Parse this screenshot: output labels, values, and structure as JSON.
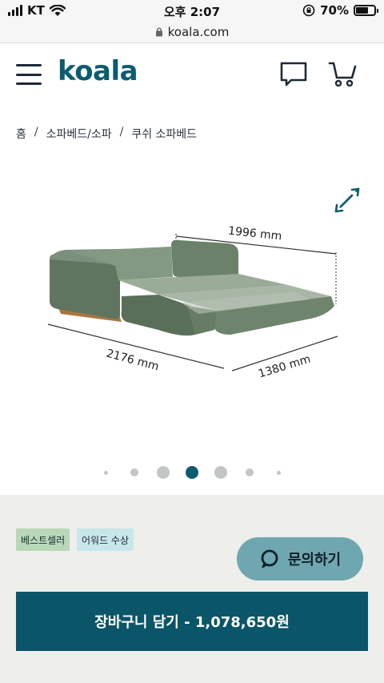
{
  "status_bar": {
    "carrier": "KT",
    "time": "오후 2:07",
    "battery": "70%",
    "battery_level": 0.7
  },
  "url_bar": {
    "domain": "koala.com"
  },
  "header": {
    "logo": "koala",
    "icons": [
      "menu-icon",
      "chat-icon",
      "cart-icon"
    ]
  },
  "breadcrumb": {
    "items": [
      "홈",
      "소파베드/소파",
      "쿠쉬 소파베드"
    ],
    "separator": "/"
  },
  "gallery": {
    "dimensions": {
      "width": "1996 mm",
      "length": "2176 mm",
      "depth": "1380 mm"
    },
    "slide_count": 7,
    "active_slide": 4
  },
  "badges": {
    "bestseller": "베스트셀러",
    "award": "어워드 수상"
  },
  "inquiry_button": {
    "label": "문의하기"
  },
  "cart_button": {
    "label": "장바구니 담기 - 1,078,650원"
  },
  "colors": {
    "brand": "#0b5c70",
    "cart_button": "#0b5568",
    "inquiry_button": "#6ea7b0",
    "badge_best": "#b8d8b8",
    "badge_award": "#c8e7ea",
    "active_dot": "#0b5c70"
  }
}
